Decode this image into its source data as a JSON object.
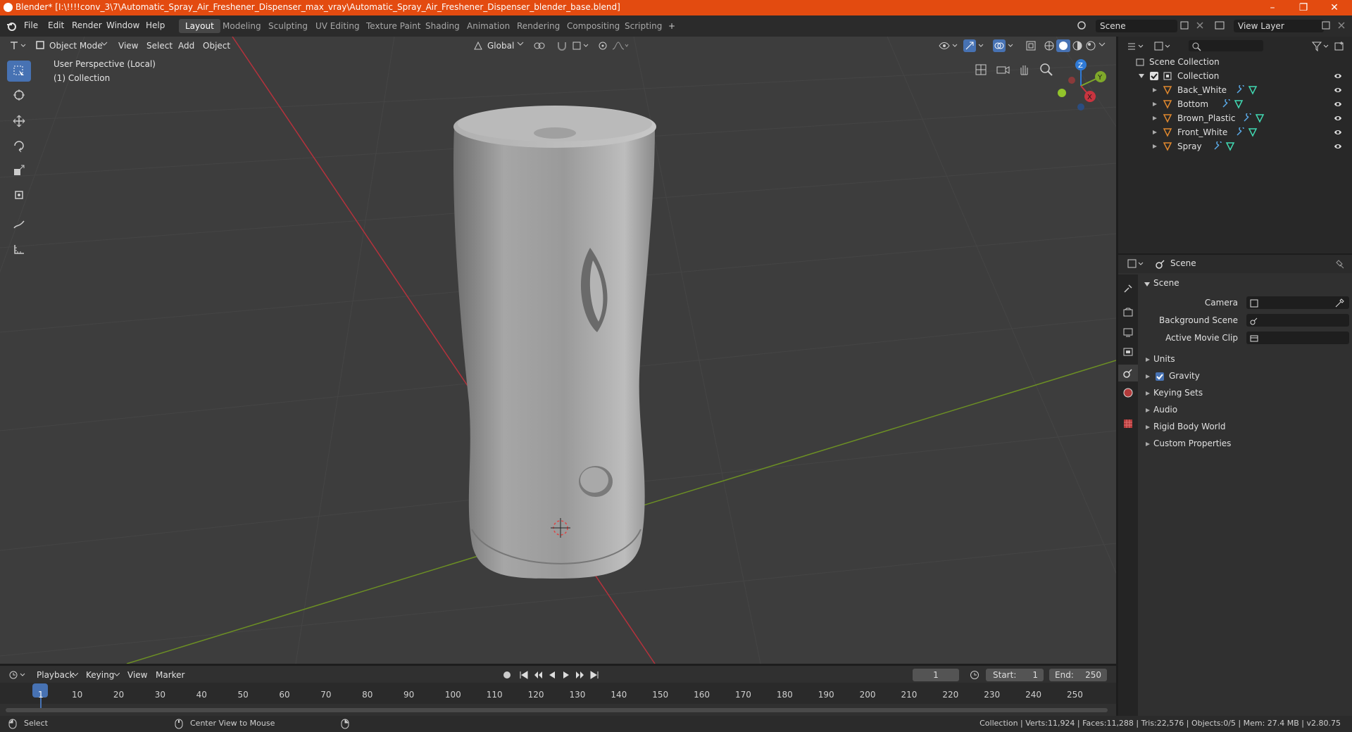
{
  "window": {
    "title": "Blender* [I:\\!!!!conv_3\\7\\Automatic_Spray_Air_Freshener_Dispenser_max_vray\\Automatic_Spray_Air_Freshener_Dispenser_blender_base.blend]",
    "minimize": "–",
    "maximize": "❐",
    "close": "✕"
  },
  "menu": {
    "file": "File",
    "edit": "Edit",
    "render": "Render",
    "window": "Window",
    "help": "Help"
  },
  "workspaces": [
    "Layout",
    "Modeling",
    "Sculpting",
    "UV Editing",
    "Texture Paint",
    "Shading",
    "Animation",
    "Rendering",
    "Compositing",
    "Scripting"
  ],
  "workspace_add": "+",
  "scene_selector": {
    "value": "Scene"
  },
  "view_layer": {
    "value": "View Layer"
  },
  "viewport": {
    "mode": "Object Mode",
    "menus": {
      "view": "View",
      "select": "Select",
      "add": "Add",
      "object": "Object"
    },
    "transform_orientation": "Global",
    "info_line1": "User Perspective (Local)",
    "info_line2": "(1) Collection",
    "gizmo": {
      "z": "Z",
      "y": "Y",
      "x": "X"
    }
  },
  "outliner": {
    "root": "Scene Collection",
    "collection": "Collection",
    "objects": [
      "Back_White",
      "Bottom",
      "Brown_Plastic",
      "Front_White",
      "Spray"
    ]
  },
  "properties": {
    "header": "Scene",
    "panel_title": "Scene",
    "camera_label": "Camera",
    "background_scene_label": "Background Scene",
    "active_movie_clip_label": "Active Movie Clip",
    "sections": [
      "Units",
      "Gravity",
      "Keying Sets",
      "Audio",
      "Rigid Body World",
      "Custom Properties"
    ],
    "gravity_checked": true
  },
  "timeline": {
    "menus": {
      "playback": "Playback",
      "keying": "Keying",
      "view": "View",
      "marker": "Marker"
    },
    "current_frame": "1",
    "start_label": "Start:",
    "start_value": "1",
    "end_label": "End:",
    "end_value": "250",
    "ticks": [
      "1",
      "10",
      "20",
      "30",
      "40",
      "50",
      "60",
      "70",
      "80",
      "90",
      "100",
      "110",
      "120",
      "130",
      "140",
      "150",
      "160",
      "170",
      "180",
      "190",
      "200",
      "210",
      "220",
      "230",
      "240",
      "250"
    ]
  },
  "statusbar": {
    "select": "Select",
    "center_view": "Center View to Mouse",
    "stats": "Collection | Verts:11,924 | Faces:11,288 | Tris:22,576 | Objects:0/5 | Mem: 27.4 MB | v2.80.75"
  },
  "colors": {
    "titlebar": "#e34b10",
    "active_tool": "#4772b3",
    "x_axis": "#c8343f",
    "y_axis": "#7fa82a",
    "z_axis": "#2f7ad6"
  }
}
